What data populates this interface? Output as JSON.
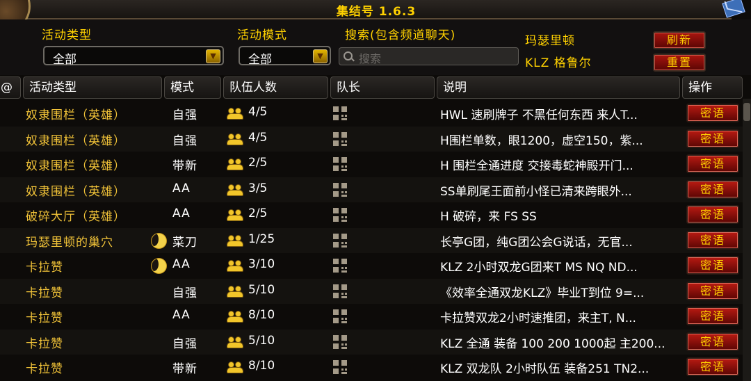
{
  "window": {
    "title": "集结号 1.6.3"
  },
  "filters": {
    "type_label": "活动类型",
    "type_value": "全部",
    "mode_label": "活动模式",
    "mode_value": "全部",
    "search_label": "搜索(包含频道聊天)",
    "search_placeholder": "搜索"
  },
  "player": {
    "realm": "玛瑟里顿",
    "name": "KLZ 格鲁尔"
  },
  "buttons": {
    "refresh": "刷新",
    "reset": "重置",
    "whisper": "密语"
  },
  "columns": {
    "at": "@",
    "type": "活动类型",
    "mode": "模式",
    "count": "队伍人数",
    "leader": "队长",
    "desc": "说明",
    "op": "操作"
  },
  "rows": [
    {
      "type": "奴隶围栏（英雄）",
      "mode": "自强",
      "count": "4/5",
      "desc": "HWL 速刷牌子 不黑任何东西 来人T...",
      "moon": false
    },
    {
      "type": "奴隶围栏（英雄）",
      "mode": "自强",
      "count": "4/5",
      "desc": "H围栏单数，眼1200，虚空150，紫...",
      "moon": false
    },
    {
      "type": "奴隶围栏（英雄）",
      "mode": "带新",
      "count": "2/5",
      "desc": " H 围栏全通进度 交接毒蛇神殿开门...",
      "moon": false
    },
    {
      "type": "奴隶围栏（英雄）",
      "mode": "AA",
      "count": "3/5",
      "desc": "SS单刷尾王面前小怪已清来跨眼外...",
      "moon": false
    },
    {
      "type": "破碎大厅（英雄）",
      "mode": "AA",
      "count": "2/5",
      "desc": "H 破碎，来 FS SS",
      "moon": false
    },
    {
      "type": "玛瑟里顿的巢穴",
      "mode": "菜刀",
      "count": "1/25",
      "desc": "长亭G团，纯G团公会G说话，无官...",
      "moon": true
    },
    {
      "type": "卡拉赞",
      "mode": "AA",
      "count": "3/10",
      "desc": "KLZ 2小时双龙G团来T MS NQ ND...",
      "moon": true
    },
    {
      "type": "卡拉赞",
      "mode": "自强",
      "count": "5/10",
      "desc": "《效率全通双龙KLZ》毕业T到位 9=...",
      "moon": false
    },
    {
      "type": "卡拉赞",
      "mode": "AA",
      "count": "8/10",
      "desc": "卡拉赞双龙2小时速推团，来主T, N...",
      "moon": false
    },
    {
      "type": "卡拉赞",
      "mode": "自强",
      "count": "5/10",
      "desc": "KLZ 全通 装备 100 200 1000起 主200...",
      "moon": false
    },
    {
      "type": "卡拉赞",
      "mode": "带新",
      "count": "8/10",
      "desc": "KLZ 双龙队 2小时队伍 装备251 TN2...",
      "moon": false
    }
  ]
}
